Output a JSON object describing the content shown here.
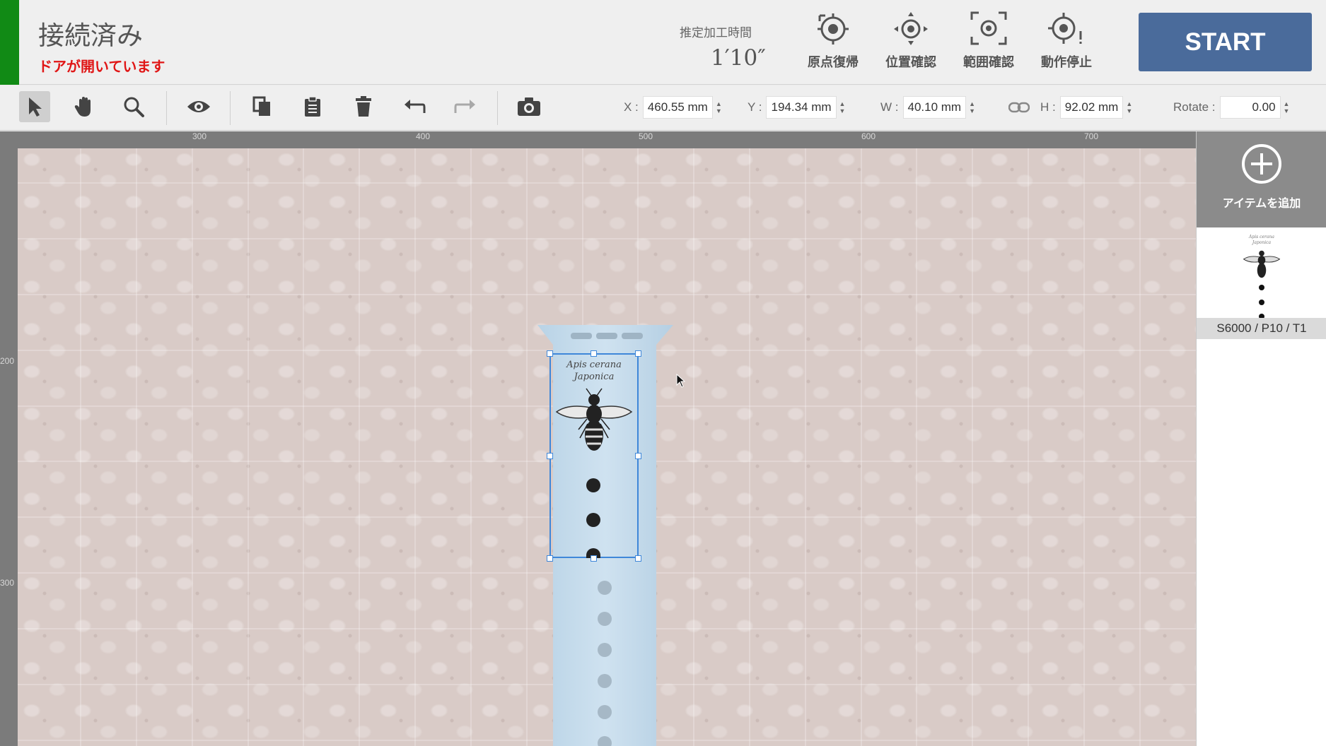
{
  "header": {
    "connection_status": "接続済み",
    "door_warning": "ドアが開いています",
    "estimated_time_label": "推定加工時間",
    "estimated_time_value": "1′10″",
    "buttons": [
      {
        "label": "原点復帰",
        "icon": "home-target-icon"
      },
      {
        "label": "位置確認",
        "icon": "position-target-icon"
      },
      {
        "label": "範囲確認",
        "icon": "frame-target-icon"
      },
      {
        "label": "動作停止",
        "icon": "stop-target-icon"
      }
    ],
    "start_label": "START",
    "colors": {
      "status": "#118a15",
      "warning": "#e01515",
      "start_bg": "#4a6b9b"
    }
  },
  "toolbar": {
    "tools": [
      "select-arrow-icon",
      "hand-pan-icon",
      "zoom-icon",
      "eye-preview-icon",
      "copy-icon",
      "paste-icon",
      "delete-icon",
      "undo-icon",
      "redo-icon",
      "camera-icon"
    ],
    "x_label": "X :",
    "x_value": "460.55 mm",
    "y_label": "Y :",
    "y_value": "194.34 mm",
    "w_label": "W :",
    "w_value": "40.10 mm",
    "h_label": "H :",
    "h_value": "92.02 mm",
    "rotate_label": "Rotate :",
    "rotate_value": "0.00"
  },
  "ruler": {
    "top": [
      "300",
      "400",
      "500",
      "600",
      "700"
    ],
    "left": [
      "200",
      "300"
    ]
  },
  "design": {
    "text_line1": "Apis cerana",
    "text_line2": "Japonica"
  },
  "sidebar": {
    "add_item_label": "アイテムを追加",
    "layer_label": "S6000 / P10 / T1",
    "layer_text_line1": "Apis cerana",
    "layer_text_line2": "Japonica"
  }
}
